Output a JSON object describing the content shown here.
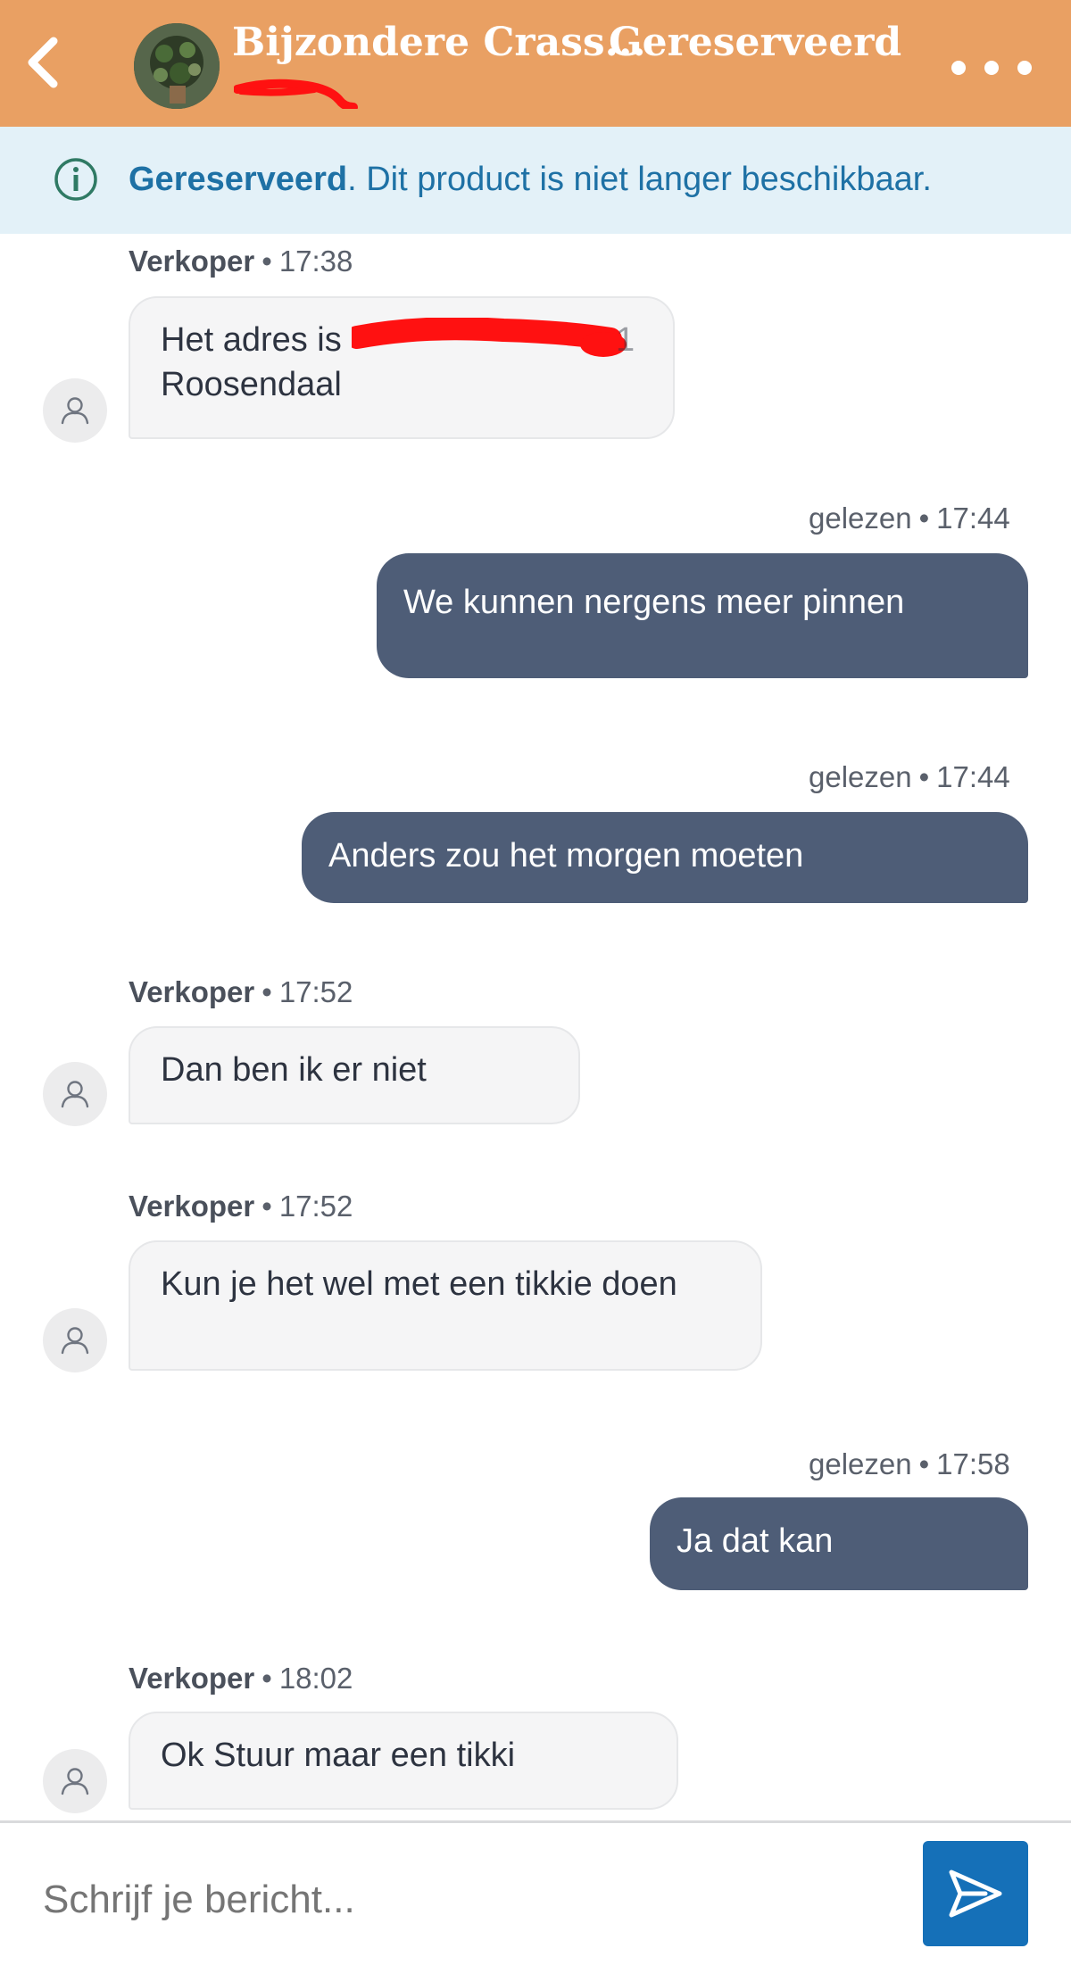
{
  "header": {
    "back_icon": "chevron-left-icon",
    "title": "Bijzondere Crass...",
    "status": "Gereserveerd",
    "more_icon": "more-horizontal-icon",
    "accent_color": "#e9a063"
  },
  "banner": {
    "icon": "info-icon",
    "bold": "Gereserveerd",
    "text": ". Dit product is niet langer beschikbaar."
  },
  "messages": [
    {
      "direction": "in",
      "sender": "Verkoper",
      "dot": "•",
      "time": "17:38",
      "line1_start": "Het adres is",
      "line1_end": "1",
      "line2": "Roosendaal"
    },
    {
      "direction": "out",
      "status": "gelezen",
      "dot": "•",
      "time": "17:44",
      "text": "We kunnen nergens meer pinnen"
    },
    {
      "direction": "out",
      "status": "gelezen",
      "dot": "•",
      "time": "17:44",
      "text": "Anders zou het morgen moeten"
    },
    {
      "direction": "in",
      "sender": "Verkoper",
      "dot": "•",
      "time": "17:52",
      "text": "Dan ben ik er niet"
    },
    {
      "direction": "in",
      "sender": "Verkoper",
      "dot": "•",
      "time": "17:52",
      "text": "Kun je het wel met een tikkie doen"
    },
    {
      "direction": "out",
      "status": "gelezen",
      "dot": "•",
      "time": "17:58",
      "text": "Ja dat kan"
    },
    {
      "direction": "in",
      "sender": "Verkoper",
      "dot": "•",
      "time": "18:02",
      "text": "Ok Stuur maar een tikki"
    }
  ],
  "composer": {
    "placeholder": "Schrijf je bericht...",
    "send_icon": "send-icon",
    "send_color": "#1570b8"
  },
  "colors": {
    "outgoing_bubble": "#4e5d77",
    "incoming_bubble": "#f5f5f6",
    "banner_bg": "#e3f1f8",
    "banner_text": "#1e71a5"
  }
}
